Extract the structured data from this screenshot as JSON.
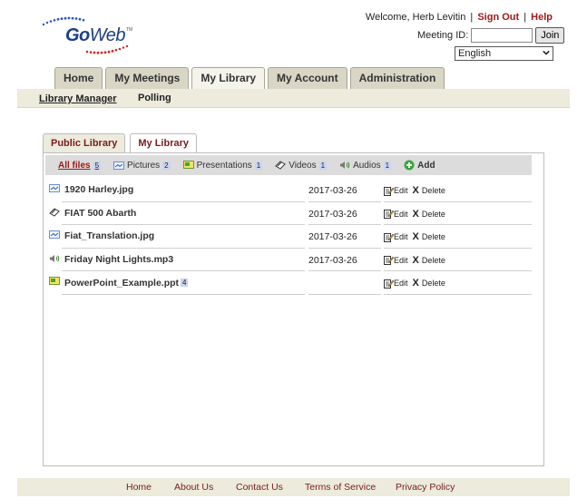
{
  "header": {
    "logo_go": "Go",
    "logo_web": "Web",
    "logo_tm": "TM",
    "welcome": "Welcome, Herb Levitin",
    "sep": "|",
    "sign_out": "Sign Out",
    "help": "Help",
    "meeting_label": "Meeting ID:",
    "meeting_value": "",
    "join": "Join",
    "language": "English"
  },
  "main_tabs": [
    "Home",
    "My Meetings",
    "My Library",
    "My Account",
    "Administration"
  ],
  "subnav": [
    "Library Manager",
    "Polling"
  ],
  "library_tabs": [
    "Public Library",
    "My Library"
  ],
  "filters": {
    "all": {
      "label": "All files",
      "count": "5"
    },
    "pictures": {
      "label": "Pictures",
      "count": "2"
    },
    "presentations": {
      "label": "Presentations",
      "count": "1"
    },
    "videos": {
      "label": "Videos",
      "count": "1"
    },
    "audios": {
      "label": "Audios",
      "count": "1"
    },
    "add": "Add"
  },
  "files": [
    {
      "name": "1920 Harley.jpg",
      "date": "2017-03-26",
      "type": "picture",
      "count": ""
    },
    {
      "name": "FIAT 500 Abarth",
      "date": "2017-03-26",
      "type": "video",
      "count": ""
    },
    {
      "name": "Fiat_Translation.jpg",
      "date": "2017-03-26",
      "type": "picture",
      "count": ""
    },
    {
      "name": "Friday Night Lights.mp3",
      "date": "2017-03-26",
      "type": "audio",
      "count": ""
    },
    {
      "name": "PowerPoint_Example.ppt",
      "date": "",
      "type": "presentation",
      "count": "4"
    }
  ],
  "actions": {
    "edit": "Edit",
    "delete_x": "X",
    "delete": "Delete"
  },
  "footer": [
    "Home",
    "About Us",
    "Contact Us",
    "Terms of Service",
    "Privacy Policy"
  ]
}
